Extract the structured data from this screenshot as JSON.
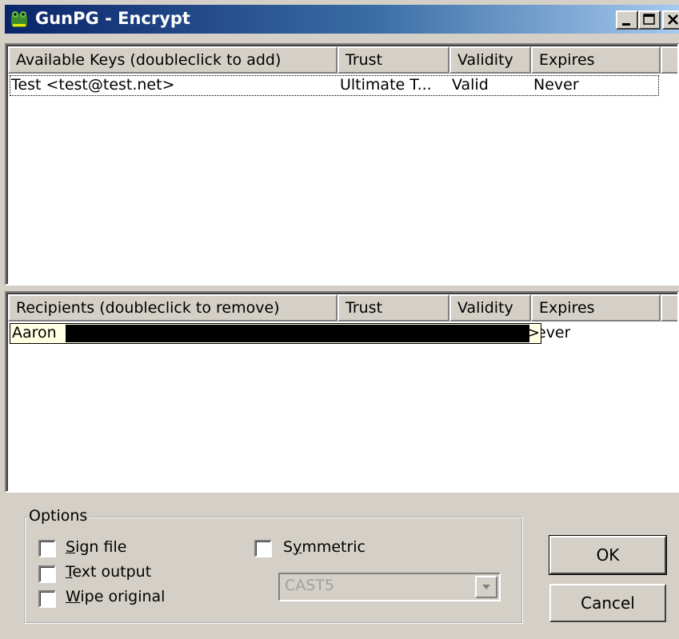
{
  "window": {
    "title": "GunPG - Encrypt",
    "icon": "frog-app-icon",
    "controls": {
      "minimize": "minimize-icon",
      "maximize": "maximize-icon",
      "close": "close-icon"
    }
  },
  "available_keys": {
    "columns": [
      "Available Keys (doubleclick to add)",
      "Trust",
      "Validity",
      "Expires"
    ],
    "rows": [
      {
        "name": "Test <test@test.net>",
        "trust": "Ultimate T...",
        "validity": "Valid",
        "expires": "Never"
      }
    ]
  },
  "recipients": {
    "columns": [
      "Recipients (doubleclick to remove)",
      "Trust",
      "Validity",
      "Expires"
    ],
    "rows": [
      {
        "name_visible": "Aaron",
        "tooltip_end": ">",
        "expires_visible": "ever"
      }
    ]
  },
  "options": {
    "group_label": "Options",
    "sign_file": {
      "label_mnemonic": "S",
      "label_rest": "ign file",
      "checked": false
    },
    "text_output": {
      "label_mnemonic": "T",
      "label_rest": "ext output",
      "checked": false
    },
    "wipe_original": {
      "label_mnemonic": "W",
      "label_rest": "ipe original",
      "checked": false
    },
    "symmetric": {
      "label_pre": "S",
      "label_mnemonic": "y",
      "label_rest": "mmetric",
      "checked": false
    },
    "cipher": {
      "value": "CAST5",
      "enabled": false
    }
  },
  "buttons": {
    "ok": "OK",
    "cancel": "Cancel"
  },
  "colors": {
    "face": "#d4d0c8",
    "title_start": "#0a246a",
    "title_end": "#a6caf0",
    "tooltip_bg": "#ffffe1"
  }
}
